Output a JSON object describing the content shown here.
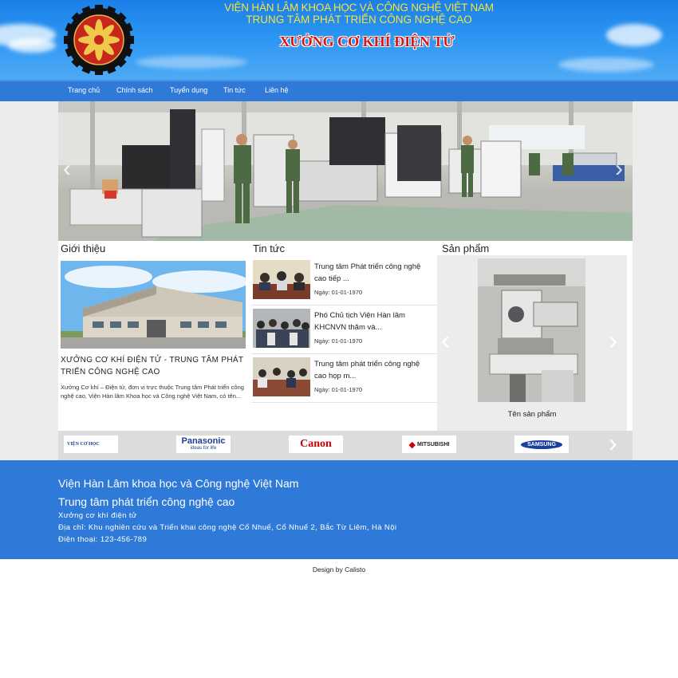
{
  "header": {
    "institute_line1": "VIỆN HÀN LÂM KHOA HỌC VÀ CÔNG NGHỆ VIỆT NAM",
    "institute_line2": "TRUNG TÂM PHÁT TRIỂN CÔNG NGHỆ CAO",
    "workshop_name": "XƯỞNG CƠ KHÍ ĐIỆN TỬ"
  },
  "nav": {
    "items": [
      {
        "label": "Trang chủ"
      },
      {
        "label": "Chính sách"
      },
      {
        "label": "Tuyển dụng"
      },
      {
        "label": "Tin tức"
      },
      {
        "label": "Liên hệ"
      }
    ]
  },
  "intro": {
    "title": "Giới thiệu",
    "heading": "XƯỞNG CƠ KHÍ ĐIỆN TỬ - TRUNG TÂM PHÁT TRIỂN CÔNG NGHỆ CAO",
    "text": "Xưởng Cơ khí – Điện tử, đơn vị trực thuộc Trung tâm Phát triển công nghệ cao, Viện Hàn lâm Khoa học và Công nghệ Việt Nam, có tên..."
  },
  "news": {
    "title": "Tin tức",
    "items": [
      {
        "title": "Trung tâm Phát triển công nghệ cao tiếp ...",
        "date": "Ngày: 01-01-1970"
      },
      {
        "title": "Phó Chủ tịch Viện Hàn lâm KHCNVN thăm và...",
        "date": "Ngày: 01-01-1970"
      },
      {
        "title": "Trung tâm phát triển công nghệ cao họp m...",
        "date": "Ngày: 01-01-1970"
      }
    ]
  },
  "products": {
    "title": "Sản phẩm",
    "name": "Tên sản phẩm"
  },
  "partners": {
    "items": [
      {
        "text": "VIỆN CƠ HỌC"
      },
      {
        "text": "Panasonic",
        "sub": "ideas for life"
      },
      {
        "text": "Canon"
      },
      {
        "text": "MITSUBISHI"
      },
      {
        "text": "SAMSUNG"
      }
    ]
  },
  "footer": {
    "line1": "Viện Hàn Lâm khoa học và Công nghệ Việt Nam",
    "line2": "Trung tâm phát triển công nghệ cao",
    "line3": "Xưởng cơ khí điện tử",
    "address": "Địa chỉ: Khu nghiên cứu và Triển khai công nghệ Cổ Nhuế, Cổ Nhuế 2, Bắc Từ Liêm, Hà Nội",
    "phone": "Điện thoại: 123-456-789"
  },
  "credit": "Design by Calisto",
  "colors": {
    "header_sky": "#2b95f2",
    "nav": "#2f7ad8",
    "footer": "#2f7ad8",
    "institute_text": "#f7e33a",
    "workshop_text": "#d41818"
  }
}
